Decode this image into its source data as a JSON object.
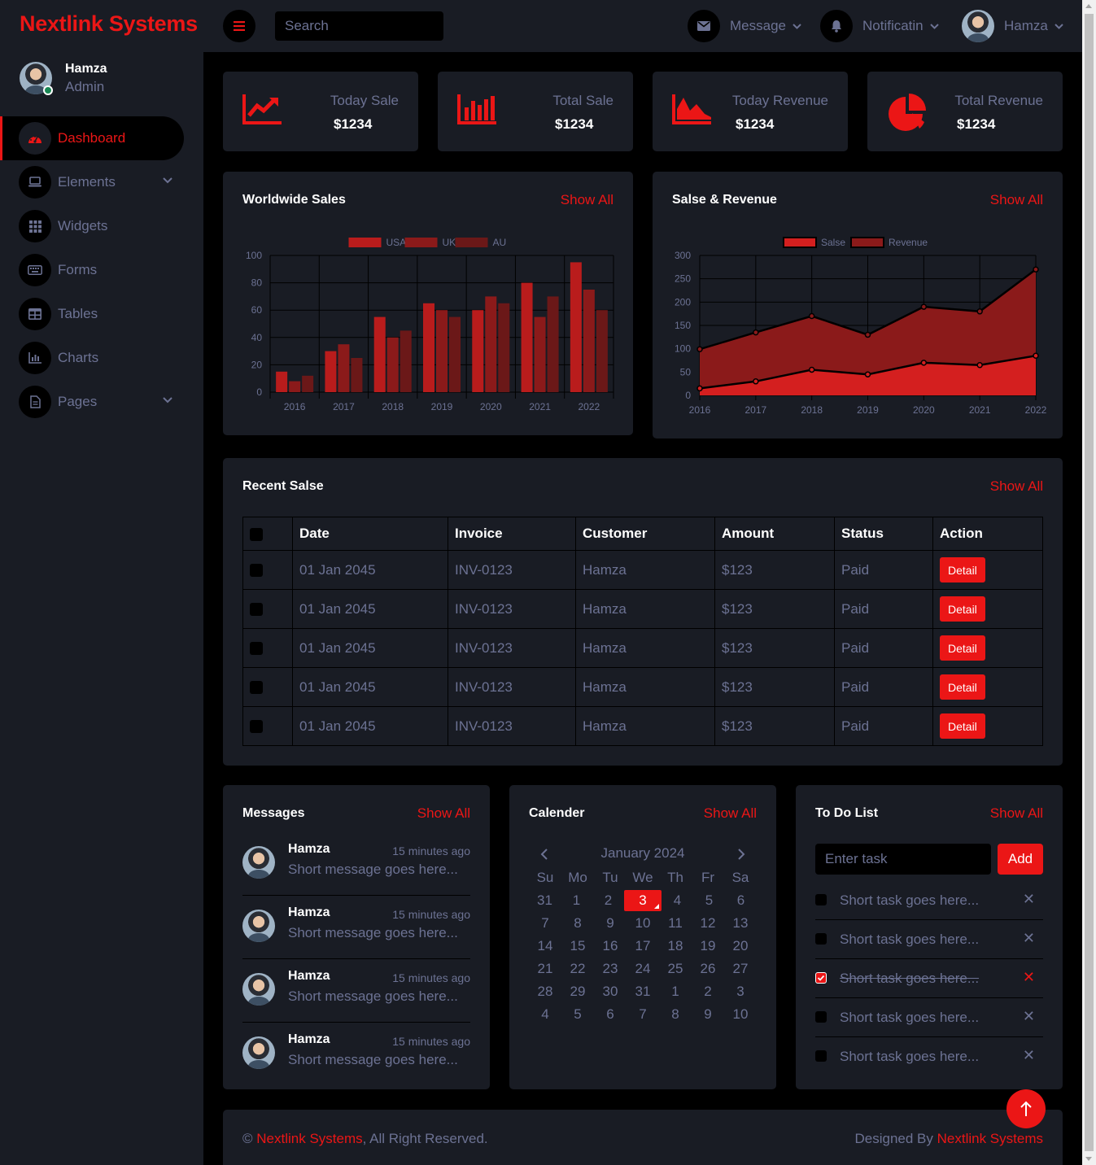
{
  "brand": "Nextlink Systems",
  "sidebar": {
    "user": {
      "name": "Hamza",
      "role": "Admin"
    },
    "items": [
      {
        "label": "Dashboard",
        "icon": "gauge-icon"
      },
      {
        "label": "Elements",
        "icon": "laptop-icon"
      },
      {
        "label": "Widgets",
        "icon": "grid-icon"
      },
      {
        "label": "Forms",
        "icon": "keyboard-icon"
      },
      {
        "label": "Tables",
        "icon": "table-icon"
      },
      {
        "label": "Charts",
        "icon": "chart-icon"
      },
      {
        "label": "Pages",
        "icon": "file-icon"
      }
    ]
  },
  "topbar": {
    "search_placeholder": "Search",
    "message_label": "Message",
    "notification_label": "Notificatin",
    "user_label": "Hamza"
  },
  "stats": [
    {
      "label": "Today Sale",
      "value": "$1234",
      "icon": "line-chart-icon"
    },
    {
      "label": "Total Sale",
      "value": "$1234",
      "icon": "bar-chart-icon"
    },
    {
      "label": "Today Revenue",
      "value": "$1234",
      "icon": "area-chart-icon"
    },
    {
      "label": "Total Revenue",
      "value": "$1234",
      "icon": "pie-chart-icon"
    }
  ],
  "show_all": "Show All",
  "worldwide": {
    "title": "Worldwide Sales"
  },
  "salesrev": {
    "title": "Salse & Revenue"
  },
  "chart_data": [
    {
      "type": "bar",
      "categories": [
        "2016",
        "2017",
        "2018",
        "2019",
        "2020",
        "2021",
        "2022"
      ],
      "series": [
        {
          "name": "USA",
          "values": [
            15,
            30,
            55,
            65,
            60,
            80,
            95
          ],
          "color": "#b91c1c"
        },
        {
          "name": "UK",
          "values": [
            8,
            35,
            40,
            60,
            70,
            55,
            75
          ],
          "color": "#8b1a1a"
        },
        {
          "name": "AU",
          "values": [
            12,
            25,
            45,
            55,
            65,
            70,
            60
          ],
          "color": "#6b1818"
        }
      ],
      "ylim": [
        0,
        100
      ],
      "yticks": [
        0,
        20,
        40,
        60,
        80,
        100
      ],
      "grid": true,
      "legend": "top-center"
    },
    {
      "type": "area",
      "x": [
        "2016",
        "2017",
        "2018",
        "2019",
        "2020",
        "2021",
        "2022"
      ],
      "series": [
        {
          "name": "Salse",
          "values": [
            15,
            30,
            55,
            45,
            70,
            65,
            85
          ],
          "color": "#d41f1f"
        },
        {
          "name": "Revenue",
          "values": [
            99,
            135,
            170,
            130,
            190,
            180,
            270
          ],
          "color": "#8b1a1a"
        }
      ],
      "ylim": [
        0,
        300
      ],
      "yticks": [
        0,
        50,
        100,
        150,
        200,
        250,
        300
      ],
      "grid": true,
      "legend": "top-center"
    }
  ],
  "recent": {
    "title": "Recent Salse",
    "headers": [
      "Date",
      "Invoice",
      "Customer",
      "Amount",
      "Status",
      "Action"
    ],
    "rows": [
      {
        "date": "01 Jan 2045",
        "invoice": "INV-0123",
        "customer": "Hamza",
        "amount": "$123",
        "status": "Paid",
        "action": "Detail"
      },
      {
        "date": "01 Jan 2045",
        "invoice": "INV-0123",
        "customer": "Hamza",
        "amount": "$123",
        "status": "Paid",
        "action": "Detail"
      },
      {
        "date": "01 Jan 2045",
        "invoice": "INV-0123",
        "customer": "Hamza",
        "amount": "$123",
        "status": "Paid",
        "action": "Detail"
      },
      {
        "date": "01 Jan 2045",
        "invoice": "INV-0123",
        "customer": "Hamza",
        "amount": "$123",
        "status": "Paid",
        "action": "Detail"
      },
      {
        "date": "01 Jan 2045",
        "invoice": "INV-0123",
        "customer": "Hamza",
        "amount": "$123",
        "status": "Paid",
        "action": "Detail"
      }
    ]
  },
  "messages": {
    "title": "Messages",
    "items": [
      {
        "name": "Hamza",
        "time": "15 minutes ago",
        "text": "Short message goes here..."
      },
      {
        "name": "Hamza",
        "time": "15 minutes ago",
        "text": "Short message goes here..."
      },
      {
        "name": "Hamza",
        "time": "15 minutes ago",
        "text": "Short message goes here..."
      },
      {
        "name": "Hamza",
        "time": "15 minutes ago",
        "text": "Short message goes here..."
      }
    ]
  },
  "calendar": {
    "title": "Calender",
    "month": "January 2024",
    "weekdays": [
      "Su",
      "Mo",
      "Tu",
      "We",
      "Th",
      "Fr",
      "Sa"
    ],
    "weeks": [
      [
        "31",
        "1",
        "2",
        "3",
        "4",
        "5",
        "6"
      ],
      [
        "7",
        "8",
        "9",
        "10",
        "11",
        "12",
        "13"
      ],
      [
        "14",
        "15",
        "16",
        "17",
        "18",
        "19",
        "20"
      ],
      [
        "21",
        "22",
        "23",
        "24",
        "25",
        "26",
        "27"
      ],
      [
        "28",
        "29",
        "30",
        "31",
        "1",
        "2",
        "3"
      ],
      [
        "4",
        "5",
        "6",
        "7",
        "8",
        "9",
        "10"
      ]
    ],
    "selected": "3"
  },
  "todo": {
    "title": "To Do List",
    "placeholder": "Enter task",
    "add_label": "Add",
    "tasks": [
      {
        "text": "Short task goes here...",
        "done": false
      },
      {
        "text": "Short task goes here...",
        "done": false
      },
      {
        "text": "Short task goes here...",
        "done": true
      },
      {
        "text": "Short task goes here...",
        "done": false
      },
      {
        "text": "Short task goes here...",
        "done": false
      }
    ]
  },
  "footer": {
    "copyright": "©",
    "brand": "Nextlink Systems",
    "rights": ", All Right Reserved.",
    "designed_by": "Designed By",
    "designer": "Nextlink Systems"
  },
  "colors": {
    "accent": "#eb1616",
    "panel": "#191c24",
    "background": "#000000",
    "muted": "#6c7293"
  }
}
